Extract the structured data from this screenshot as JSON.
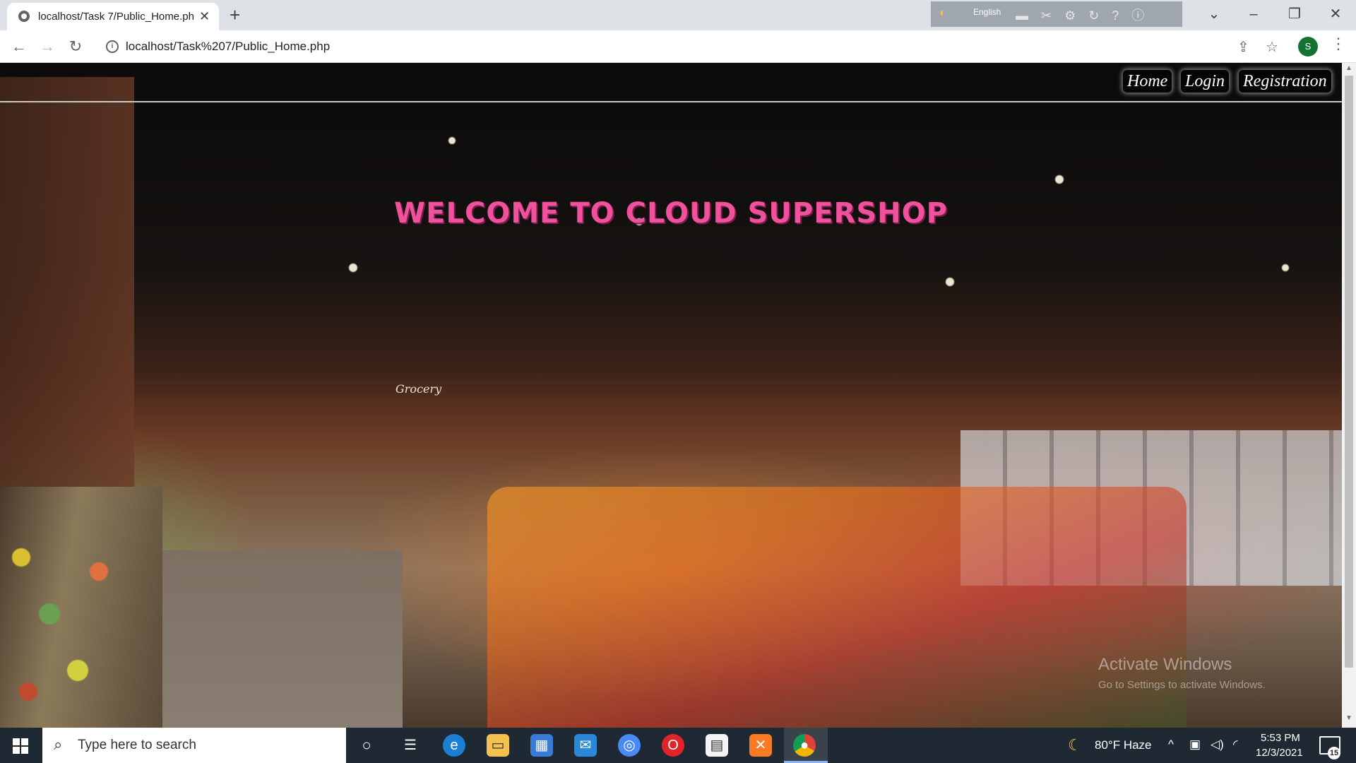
{
  "browser": {
    "tab_title": "localhost/Task 7/Public_Home.ph",
    "url": "localhost/Task%207/Public_Home.php",
    "profile_initial": "S",
    "language_bar": {
      "label": "English"
    }
  },
  "page": {
    "nav": [
      {
        "label": "Home"
      },
      {
        "label": "Login"
      },
      {
        "label": "Registration"
      }
    ],
    "welcome_text": "WELCOME TO CLOUD SUPERSHOP",
    "store_sign": "Grocery",
    "watermark": {
      "title": "Activate Windows",
      "subtitle": "Go to Settings to activate Windows."
    },
    "colors": {
      "welcome": "#f0519c",
      "nav_text": "#ffffff"
    }
  },
  "taskbar": {
    "search_placeholder": "Type here to search",
    "weather": "80°F  Haze",
    "time": "5:53 PM",
    "date": "12/3/2021",
    "notification_count": "15",
    "apps": [
      "cortana-icon",
      "task-view-icon",
      "edge-icon",
      "file-explorer-icon",
      "store-icon",
      "mail-icon",
      "chromium-icon",
      "opera-icon",
      "notepad-icon",
      "xampp-icon",
      "chrome-icon"
    ]
  }
}
